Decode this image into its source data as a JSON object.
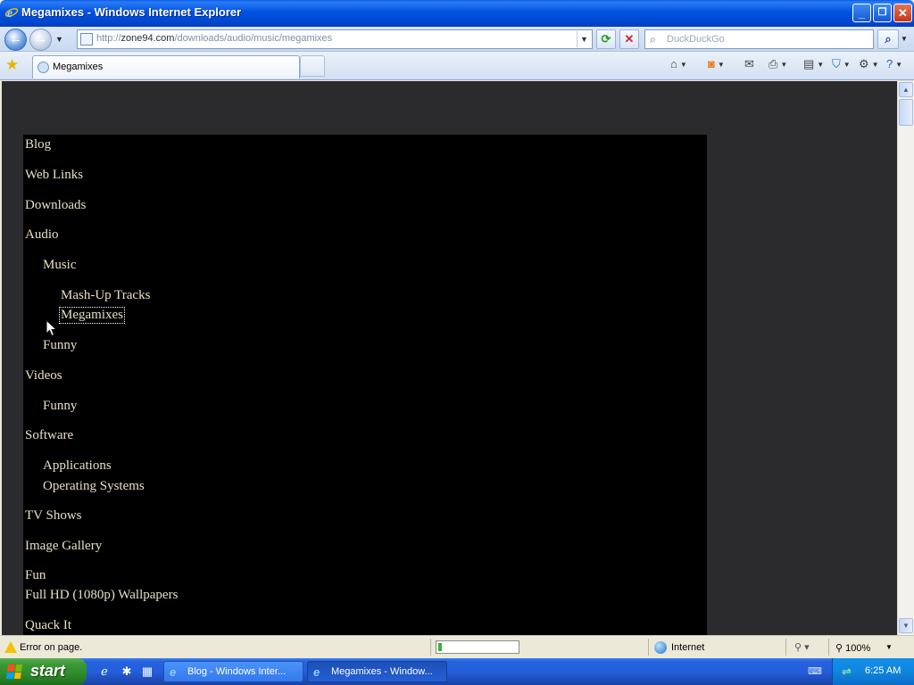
{
  "window": {
    "title": "Megamixes - Windows Internet Explorer",
    "minimize": "_",
    "restore": "❐",
    "close": "✕"
  },
  "address": {
    "prefix": "http://",
    "domain": "zone94.com",
    "path": "/downloads/audio/music/megamixes"
  },
  "search": {
    "placeholder": "DuckDuckGo"
  },
  "tabs": [
    {
      "label": "Megamixes"
    }
  ],
  "page": {
    "nav": [
      {
        "label": "Blog"
      },
      {
        "label": "Web Links"
      },
      {
        "label": "Downloads"
      },
      {
        "label": "Audio"
      },
      {
        "label": "Music"
      },
      {
        "label": "Mash-Up Tracks"
      },
      {
        "label": "Megamixes"
      },
      {
        "label": "Funny"
      },
      {
        "label": "Videos"
      },
      {
        "label": "Funny"
      },
      {
        "label": "Software"
      },
      {
        "label": "Applications"
      },
      {
        "label": "Operating Systems"
      },
      {
        "label": "TV Shows"
      },
      {
        "label": "Image Gallery"
      },
      {
        "label": "Fun"
      },
      {
        "label": "Full HD (1080p) Wallpapers"
      },
      {
        "label": "Quack It"
      }
    ],
    "current_item": "Megamixes"
  },
  "statusbar": {
    "message": "Error on page.",
    "progress": 0.04,
    "zone": "Internet",
    "zoom": "100%"
  },
  "taskbar": {
    "start": "start",
    "tasks": [
      {
        "label": "Blog - Windows Inter...",
        "active": false
      },
      {
        "label": "Megamixes - Window...",
        "active": true
      }
    ],
    "clock": "6:25 AM"
  },
  "colors": {
    "page_bg": "#2b2b2d",
    "panel_bg": "#000000",
    "link": "#e9dfc4",
    "titlebar": "#0053e0",
    "start": "#3c9a37"
  }
}
